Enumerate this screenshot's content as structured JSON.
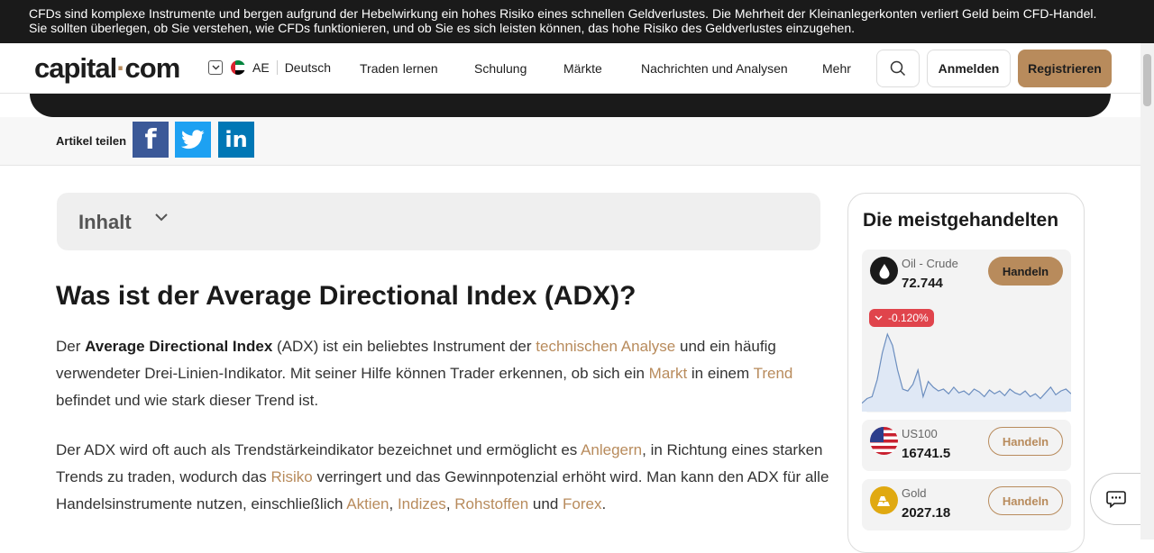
{
  "risk_banner": {
    "line1": "CFDs sind komplexe Instrumente und bergen aufgrund der Hebelwirkung ein hohes Risiko eines schnellen Geldverlustes. Die Mehrheit der Kleinanlegerkonten verliert Geld beim CFD-Handel.",
    "line2": "Sie sollten überlegen, ob Sie verstehen, wie CFDs funktionieren, und ob Sie es sich leisten können, das hohe Risiko des Geldverlustes einzugehen."
  },
  "header": {
    "logo_left": "capital",
    "logo_dot": "·",
    "logo_right": "com",
    "region_code": "AE",
    "language": "Deutsch",
    "nav": [
      "Traden lernen",
      "Schulung",
      "Märkte",
      "Nachrichten und Analysen",
      "Mehr"
    ],
    "login": "Anmelden",
    "register": "Registrieren"
  },
  "share": {
    "label": "Artikel teilen",
    "facebook_icon": "f",
    "linkedin_icon": "in"
  },
  "toc": {
    "label": "Inhalt"
  },
  "article": {
    "title": "Was ist der Average Directional Index (ADX)?",
    "p1": {
      "t1": "Der ",
      "bold": "Average Directional Index",
      "t2": " (ADX) ist ein beliebtes Instrument der ",
      "link1": "technischen Analyse",
      "t3": " und ein häufig verwendeter Drei-Linien-Indikator. Mit seiner Hilfe können Trader erkennen, ob sich ein ",
      "link2": "Markt",
      "t4": " in einem ",
      "link3": "Trend",
      "t5": " befindet und wie stark dieser Trend ist."
    },
    "p2": {
      "t1": "Der ADX wird oft auch als Trendstärkeindikator bezeichnet und ermöglicht es ",
      "link1": "Anlegern",
      "t2": ", in Richtung eines starken Trends zu traden, wodurch das ",
      "link2": "Risiko",
      "t3": " verringert und das Gewinnpotenzial erhöht wird. Man kann den ADX für alle Handelsinstrumente nutzen, einschließlich ",
      "link3": "Aktien",
      "t4": ", ",
      "link4": "Indizes",
      "t5": ", ",
      "link5": "Rohstoffen",
      "t6": " und ",
      "link6": "Forex",
      "t7": "."
    }
  },
  "widget": {
    "title": "Die meistgehandelten",
    "instruments": [
      {
        "name": "Oil - Crude",
        "price": "72.744",
        "change": "-0.120%",
        "action": "Handeln",
        "icon": "oil-drop-icon"
      },
      {
        "name": "US100",
        "price": "16741.5",
        "action": "Handeln",
        "icon": "us-flag-icon"
      },
      {
        "name": "Gold",
        "price": "2027.18",
        "action": "Handeln",
        "icon": "gold-bars-icon"
      }
    ],
    "sparkline": [
      5,
      10,
      12,
      30,
      58,
      78,
      66,
      40,
      20,
      18,
      25,
      40,
      12,
      28,
      22,
      18,
      20,
      15,
      22,
      16,
      18,
      14,
      20,
      17,
      12,
      19,
      15,
      18,
      13,
      20,
      16,
      14,
      18,
      12,
      15,
      10,
      16,
      22,
      14,
      18,
      20,
      15
    ]
  },
  "colors": {
    "accent": "#b88b5c",
    "dark": "#1a1a1a",
    "negative": "#e0444c",
    "chart_line": "#6c8ebf"
  }
}
